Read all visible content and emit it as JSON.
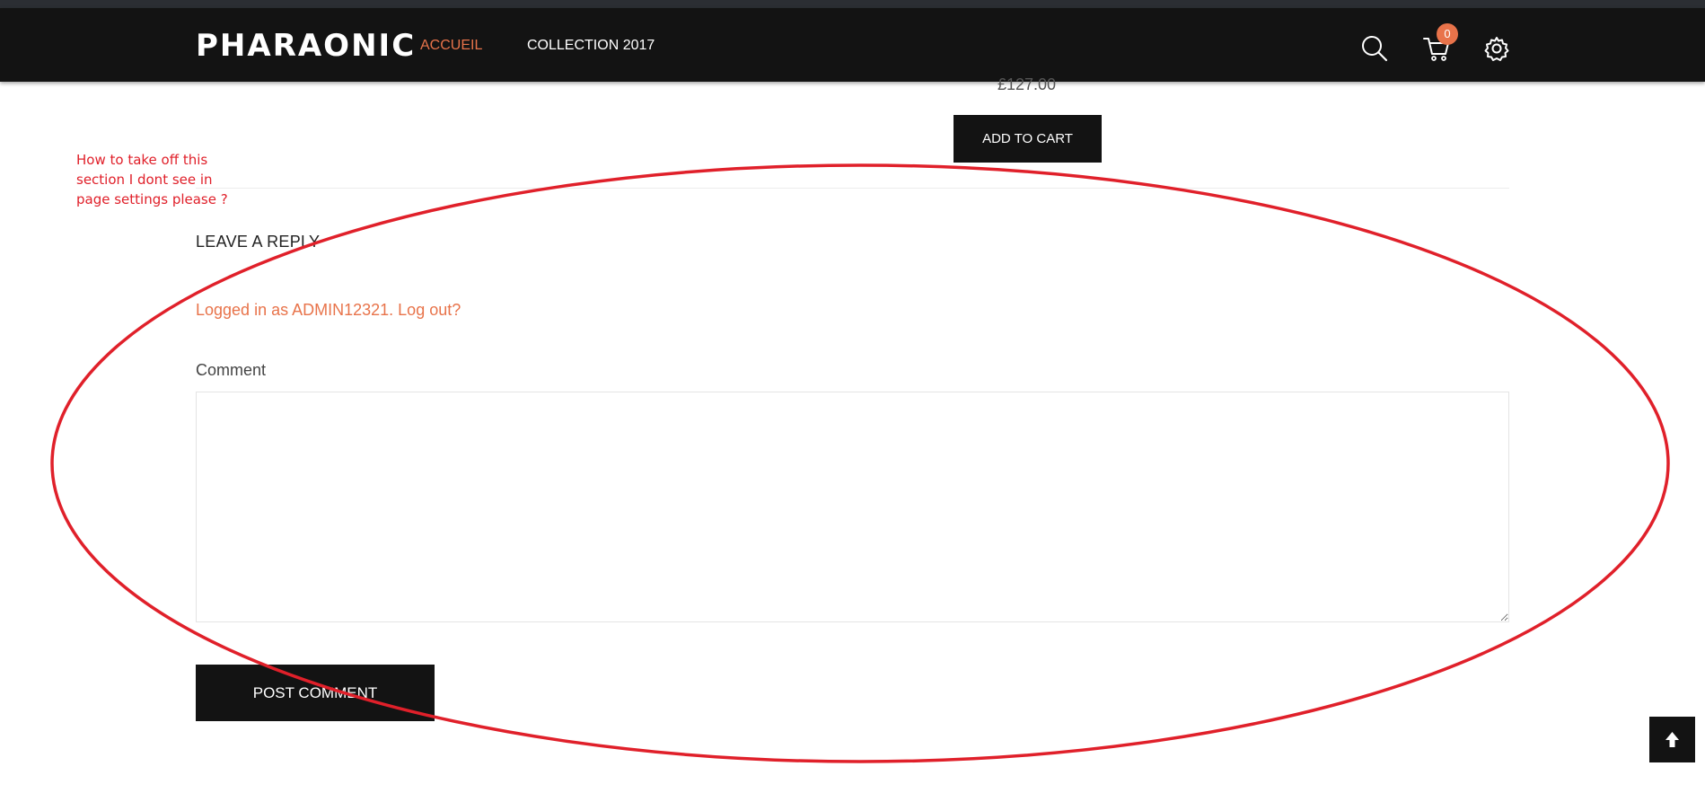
{
  "header": {
    "logo_text": "PHARAONIC",
    "nav": [
      {
        "label": "ACCUEIL",
        "active": true
      },
      {
        "label": "COLLECTION 2017",
        "active": false
      }
    ],
    "cart_count": "0",
    "icons": [
      "search-icon",
      "cart-icon",
      "gear-icon"
    ],
    "accent_color": "#e8734a"
  },
  "product": {
    "price": "£127.00",
    "add_to_cart_label": "ADD TO CART"
  },
  "annotation": {
    "text": "How to take off this section I dont see in page settings please ?",
    "color": "#e0202a"
  },
  "comments": {
    "heading": "LEAVE A REPLY",
    "logged_in_prefix": "Logged in as ADMIN12321.",
    "logout_label": "Log out?",
    "comment_label": "Comment",
    "comment_value": "",
    "post_button_label": "POST COMMENT"
  },
  "back_to_top_icon": "arrow-up-icon"
}
